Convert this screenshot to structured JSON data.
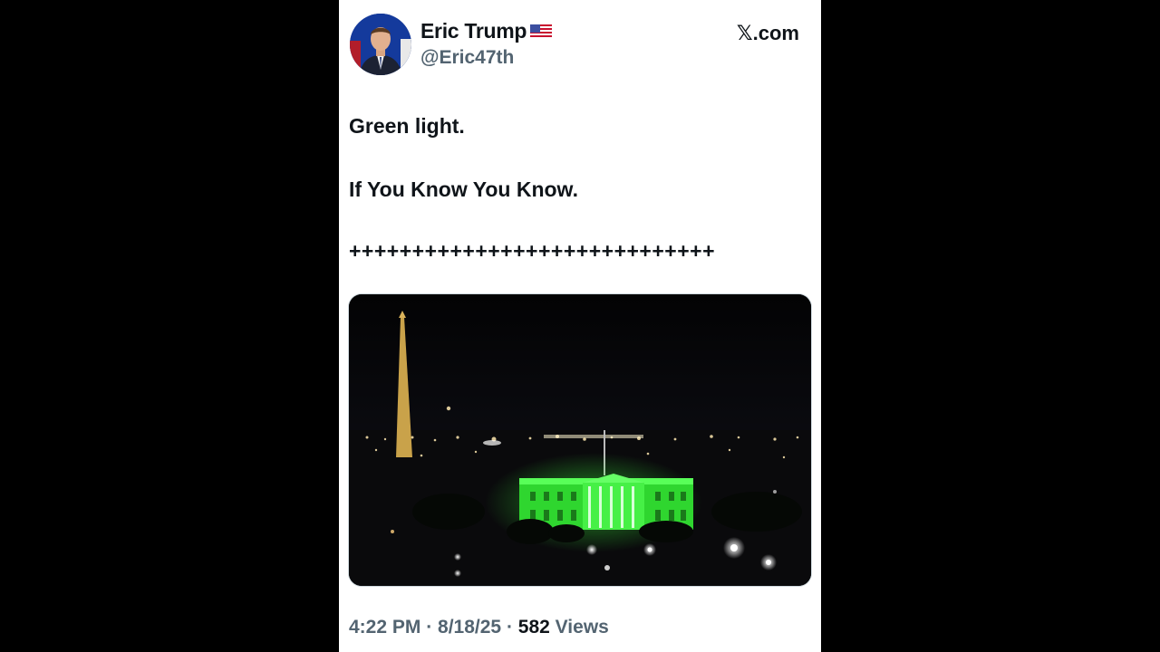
{
  "author": {
    "name": "Eric Trump",
    "flag_icon": "us-flag-icon",
    "handle": "@Eric47th",
    "avatar_icon": "profile-photo"
  },
  "brand": {
    "x_glyph": "𝕏",
    "suffix": ".com"
  },
  "tweet": {
    "line1": "Green light.",
    "line2": "If You Know You Know.",
    "line3": "+++++++++++++++++++++++++++++"
  },
  "media": {
    "description_icon": "night-photo-white-house-green",
    "colors": {
      "sky": "#050508",
      "monument": "#c9a24a",
      "white_house": "#3cff3c"
    }
  },
  "meta": {
    "time": "4:22 PM",
    "sep1": " · ",
    "date": "8/18/25",
    "sep2": " · ",
    "views_count": "582",
    "views_label": " Views"
  }
}
